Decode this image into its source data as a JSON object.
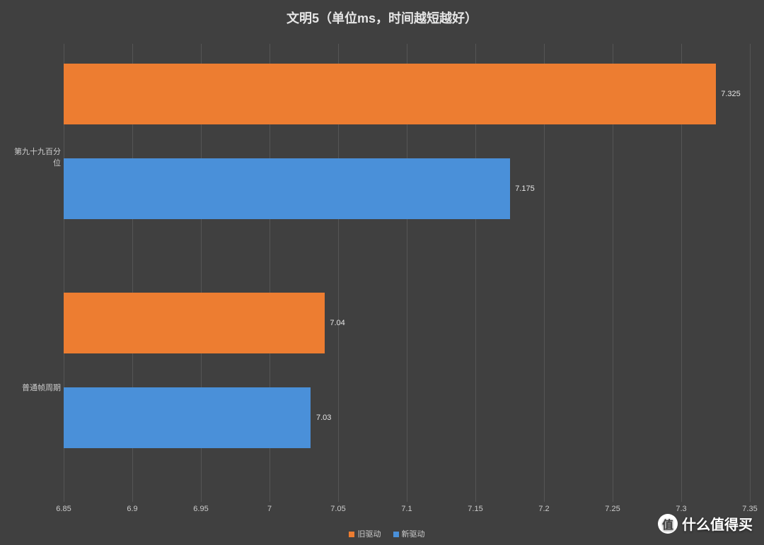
{
  "chart_data": {
    "type": "bar",
    "orientation": "horizontal",
    "title": "文明5（单位ms，时间越短越好）",
    "xlabel": "",
    "ylabel": "",
    "xlim": [
      6.85,
      7.35
    ],
    "x_ticks": [
      6.85,
      6.9,
      6.95,
      7,
      7.05,
      7.1,
      7.15,
      7.2,
      7.25,
      7.3,
      7.35
    ],
    "categories": [
      "第九十九百分位",
      "普通帧周期"
    ],
    "series": [
      {
        "name": "旧驱动",
        "color": "#ed7d31",
        "values": [
          7.325,
          7.04
        ]
      },
      {
        "name": "新驱动",
        "color": "#4a90d9",
        "values": [
          7.175,
          7.03
        ]
      }
    ]
  },
  "legend": {
    "old_driver": "旧驱动",
    "new_driver": "新驱动"
  },
  "watermark": {
    "badge": "值",
    "text": "什么值得买"
  }
}
